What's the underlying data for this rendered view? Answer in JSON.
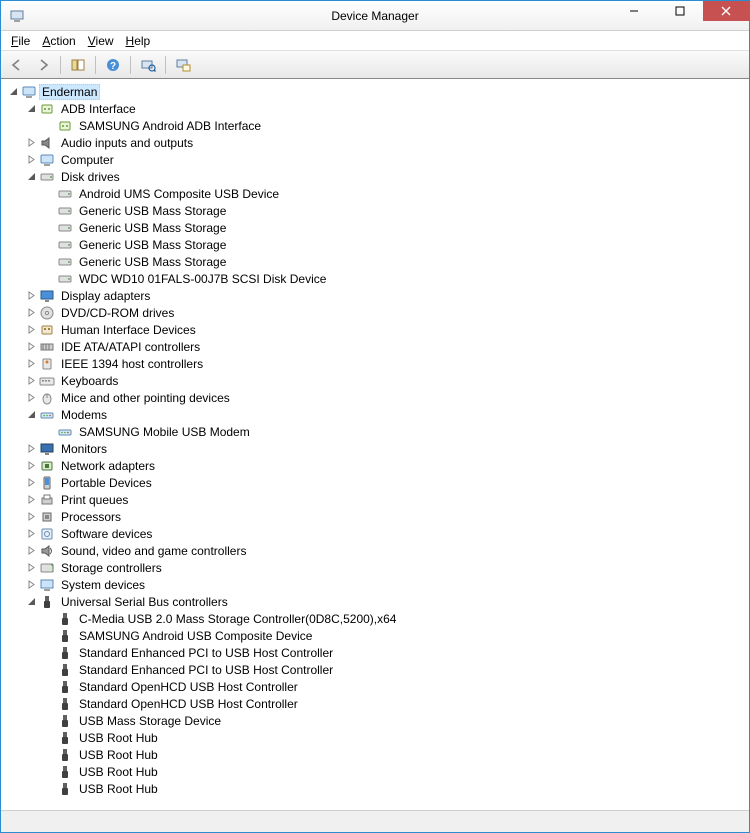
{
  "window": {
    "title": "Device Manager"
  },
  "menu": {
    "file": "File",
    "action": "Action",
    "view": "View",
    "help": "Help"
  },
  "tree": {
    "root": {
      "label": "Enderman",
      "selected": true,
      "expanded": true,
      "icon": "computer"
    },
    "categories": [
      {
        "label": "ADB Interface",
        "expanded": true,
        "icon": "adb",
        "children": [
          {
            "label": "SAMSUNG Android ADB Interface",
            "icon": "adb"
          }
        ]
      },
      {
        "label": "Audio inputs and outputs",
        "expanded": false,
        "icon": "audio"
      },
      {
        "label": "Computer",
        "expanded": false,
        "icon": "computer"
      },
      {
        "label": "Disk drives",
        "expanded": true,
        "icon": "disk",
        "children": [
          {
            "label": "Android   UMS Composite USB Device",
            "icon": "disk"
          },
          {
            "label": "Generic USB Mass Storage",
            "icon": "disk"
          },
          {
            "label": "Generic USB Mass Storage",
            "icon": "disk"
          },
          {
            "label": "Generic USB Mass Storage",
            "icon": "disk"
          },
          {
            "label": "Generic USB Mass Storage",
            "icon": "disk"
          },
          {
            "label": "WDC WD10 01FALS-00J7B SCSI Disk Device",
            "icon": "disk"
          }
        ]
      },
      {
        "label": "Display adapters",
        "expanded": false,
        "icon": "display"
      },
      {
        "label": "DVD/CD-ROM drives",
        "expanded": false,
        "icon": "dvd"
      },
      {
        "label": "Human Interface Devices",
        "expanded": false,
        "icon": "hid"
      },
      {
        "label": "IDE ATA/ATAPI controllers",
        "expanded": false,
        "icon": "ide"
      },
      {
        "label": "IEEE 1394 host controllers",
        "expanded": false,
        "icon": "firewire"
      },
      {
        "label": "Keyboards",
        "expanded": false,
        "icon": "keyboard"
      },
      {
        "label": "Mice and other pointing devices",
        "expanded": false,
        "icon": "mouse"
      },
      {
        "label": "Modems",
        "expanded": true,
        "icon": "modem",
        "children": [
          {
            "label": "SAMSUNG Mobile USB Modem",
            "icon": "modem"
          }
        ]
      },
      {
        "label": "Monitors",
        "expanded": false,
        "icon": "monitor"
      },
      {
        "label": "Network adapters",
        "expanded": false,
        "icon": "network"
      },
      {
        "label": "Portable Devices",
        "expanded": false,
        "icon": "portable"
      },
      {
        "label": "Print queues",
        "expanded": false,
        "icon": "print"
      },
      {
        "label": "Processors",
        "expanded": false,
        "icon": "cpu"
      },
      {
        "label": "Software devices",
        "expanded": false,
        "icon": "software"
      },
      {
        "label": "Sound, video and game controllers",
        "expanded": false,
        "icon": "sound"
      },
      {
        "label": "Storage controllers",
        "expanded": false,
        "icon": "storage"
      },
      {
        "label": "System devices",
        "expanded": false,
        "icon": "system"
      },
      {
        "label": "Universal Serial Bus controllers",
        "expanded": true,
        "icon": "usb",
        "children": [
          {
            "label": "C-Media USB 2.0 Mass Storage Controller(0D8C,5200),x64",
            "icon": "usb"
          },
          {
            "label": "SAMSUNG Android USB Composite Device",
            "icon": "usb"
          },
          {
            "label": "Standard Enhanced PCI to USB Host Controller",
            "icon": "usb"
          },
          {
            "label": "Standard Enhanced PCI to USB Host Controller",
            "icon": "usb"
          },
          {
            "label": "Standard OpenHCD USB Host Controller",
            "icon": "usb"
          },
          {
            "label": "Standard OpenHCD USB Host Controller",
            "icon": "usb"
          },
          {
            "label": "USB Mass Storage Device",
            "icon": "usb"
          },
          {
            "label": "USB Root Hub",
            "icon": "usb"
          },
          {
            "label": "USB Root Hub",
            "icon": "usb"
          },
          {
            "label": "USB Root Hub",
            "icon": "usb"
          },
          {
            "label": "USB Root Hub",
            "icon": "usb"
          }
        ]
      }
    ]
  }
}
